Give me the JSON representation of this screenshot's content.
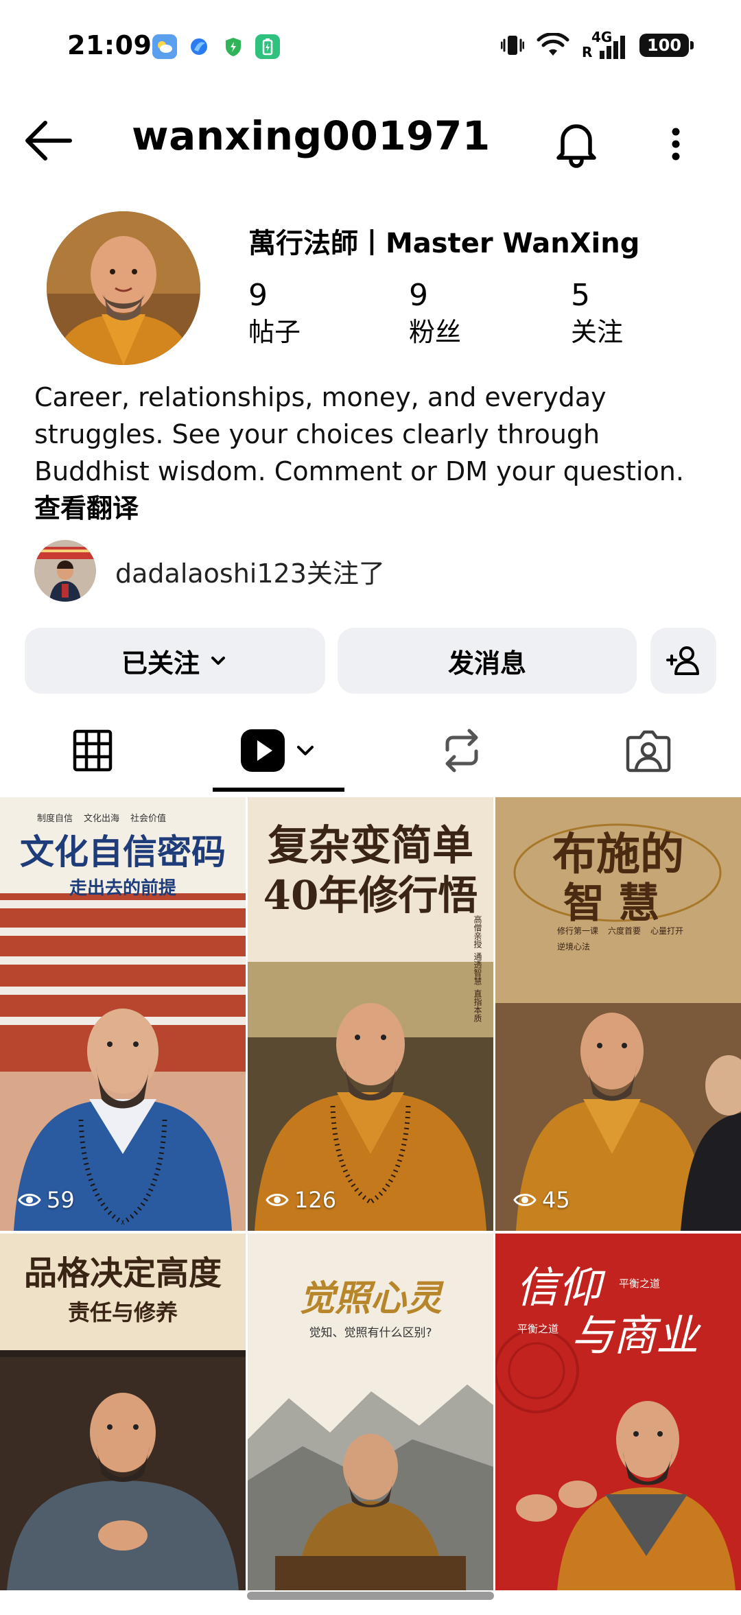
{
  "status_bar": {
    "time": "21:09",
    "network": "4G",
    "roaming": "R",
    "battery": "100"
  },
  "header": {
    "username": "wanxing001971"
  },
  "profile": {
    "display_name": "萬行法師丨Master WanXing",
    "stats": [
      {
        "value": "9",
        "label": "帖子"
      },
      {
        "value": "9",
        "label": "粉丝"
      },
      {
        "value": "5",
        "label": "关注"
      }
    ],
    "bio": "Career, relationships, money, and everyday struggles. See your choices clearly through Buddhist wisdom. Comment or DM your question.",
    "see_translation": "查看翻译",
    "followed_by": "dadalaoshi123关注了"
  },
  "actions": {
    "following_label": "已关注",
    "message_label": "发消息"
  },
  "posts": [
    {
      "title": "文化自信密码",
      "subtitle": "走出去的前提",
      "tags": [
        "制度自信",
        "文化出海",
        "社会价值"
      ],
      "views": "59",
      "robe": "#2a5aa0"
    },
    {
      "title_line1": "复杂变简单",
      "title_line2": "40年修行悟",
      "tags": [
        "直指本质",
        "通透智慧",
        "高僧亲授"
      ],
      "views": "126",
      "robe": "#c47a1c"
    },
    {
      "title_line1": "布施的",
      "title_line2": "智慧",
      "tags": [
        "修行第一课",
        "六度首要",
        "心量打开",
        "逆境心法"
      ],
      "views": "45",
      "robe": "#c7811e"
    },
    {
      "title": "品格决定高度",
      "subtitle": "责任与修养",
      "robe": "#4f5e6a"
    },
    {
      "title": "觉照心灵",
      "subtitle": "觉知、觉照有什么区别?",
      "robe": "#9a6a24"
    },
    {
      "title_line1": "信仰",
      "title_line2": "与商业",
      "tags": [
        "平衡之道",
        "平衡之道"
      ],
      "robe": "#c97a1e"
    }
  ]
}
